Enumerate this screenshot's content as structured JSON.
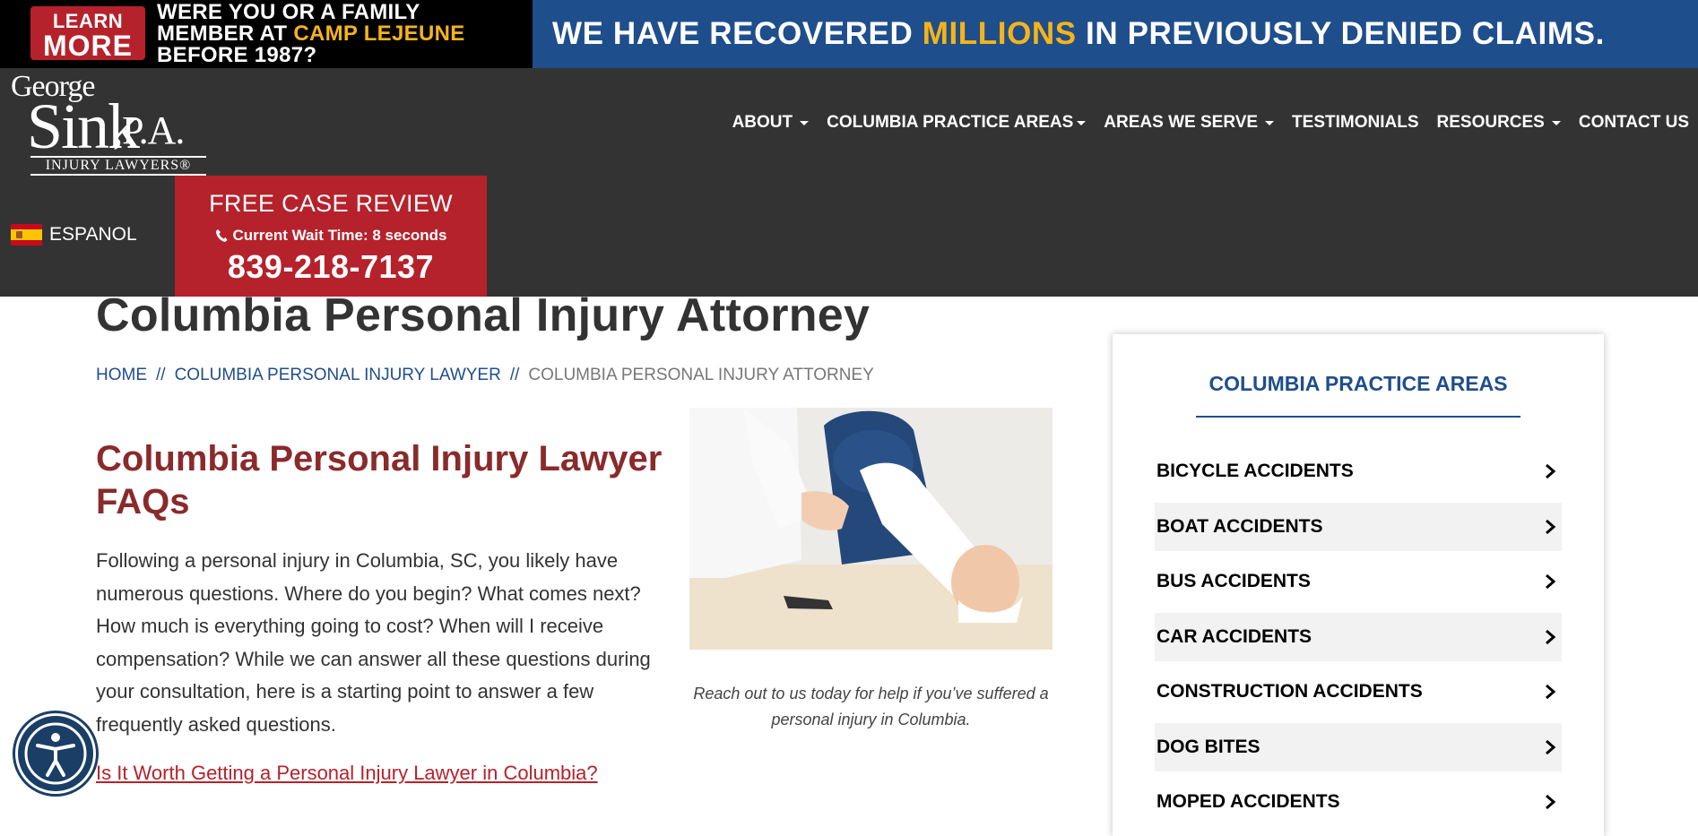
{
  "banner": {
    "learn_line1": "LEARN",
    "learn_line2": "MORE",
    "question_line1": "WERE YOU OR A FAMILY",
    "question_line2_a": "MEMBER AT ",
    "question_line2_b": "CAMP LEJEUNE",
    "question_line3": "BEFORE 1987?",
    "claim_a": "WE HAVE RECOVERED ",
    "claim_b": "MILLIONS",
    "claim_c": " IN PREVIOUSLY DENIED CLAIMS.",
    "accent_color": "#f5b41a",
    "brand_blue": "#1f4e8c",
    "brand_red": "#b5222b"
  },
  "logo": {
    "line1": "George",
    "line2": "Sink",
    "line3": ",P.A.",
    "line4": "INJURY LAWYERS®"
  },
  "nav": {
    "items": [
      {
        "label": "ABOUT",
        "has_caret": true
      },
      {
        "label": "COLUMBIA PRACTICE AREAS",
        "has_caret": true
      },
      {
        "label": "AREAS WE SERVE",
        "has_caret": true
      },
      {
        "label": "TESTIMONIALS",
        "has_caret": false
      },
      {
        "label": "RESOURCES",
        "has_caret": true
      },
      {
        "label": "CONTACT US",
        "has_caret": false
      }
    ]
  },
  "language": {
    "label": "ESPANOL",
    "icon": "spain-flag-icon"
  },
  "case_review": {
    "title": "FREE CASE REVIEW",
    "wait_text": "Current Wait Time: 8 seconds",
    "phone": "839-218-7137",
    "icon": "phone-icon"
  },
  "main": {
    "title": "Columbia Personal Injury Attorney",
    "breadcrumb": {
      "home": "HOME",
      "sep": "//",
      "parent": "COLUMBIA PERSONAL INJURY LAWYER",
      "current": "COLUMBIA PERSONAL INJURY ATTORNEY"
    },
    "faq_heading": "Columbia Personal Injury Lawyer FAQs",
    "body": "Following a personal injury in Columbia, SC, you likely have numerous questions. Where do you begin? What comes next? How much is everything going to cost? When will I receive compensation? While we can answer all these questions during your consultation, here is a starting point to answer a few frequently asked questions.",
    "faq_link": "Is It Worth Getting a Personal Injury Lawyer in Columbia?",
    "image_caption": "Reach out to us today for help if you’ve suffered a personal injury in Columbia."
  },
  "sidebar": {
    "title": "COLUMBIA PRACTICE AREAS",
    "items": [
      {
        "label": "BICYCLE ACCIDENTS"
      },
      {
        "label": "BOAT ACCIDENTS"
      },
      {
        "label": "BUS ACCIDENTS"
      },
      {
        "label": "CAR ACCIDENTS"
      },
      {
        "label": "CONSTRUCTION ACCIDENTS"
      },
      {
        "label": "DOG BITES"
      },
      {
        "label": "MOPED ACCIDENTS"
      }
    ]
  },
  "accessibility": {
    "icon": "accessibility-icon"
  }
}
